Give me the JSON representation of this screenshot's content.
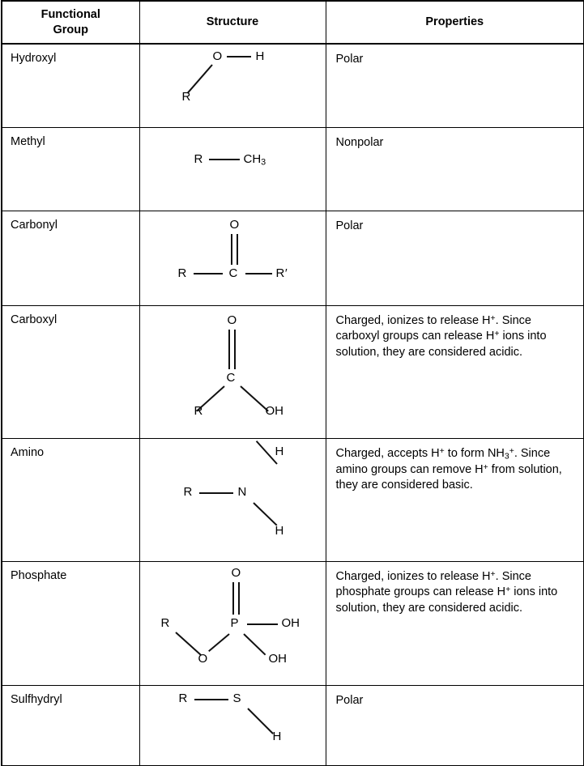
{
  "table": {
    "headers": {
      "group": "Functional Group",
      "group_line1": "Functional",
      "group_line2": "Group",
      "structure": "Structure",
      "properties": "Properties"
    },
    "rows": [
      {
        "group": "Hydroxyl",
        "structure_atoms": [
          "O",
          "H",
          "R"
        ],
        "structure_formula": "R-O-H",
        "properties": "Polar"
      },
      {
        "group": "Methyl",
        "structure_atoms": [
          "R",
          "CH3"
        ],
        "structure_formula": "R-CH3",
        "properties": "Nonpolar"
      },
      {
        "group": "Carbonyl",
        "structure_atoms": [
          "O",
          "R",
          "C",
          "R′"
        ],
        "structure_formula": "R-C(=O)-R′",
        "properties": "Polar"
      },
      {
        "group": "Carboxyl",
        "structure_atoms": [
          "O",
          "C",
          "R",
          "OH"
        ],
        "structure_formula": "R-C(=O)-OH",
        "properties": "Charged, ionizes to release H+. Since carboxyl groups can release H+ ions into solution, they are considered acidic."
      },
      {
        "group": "Amino",
        "structure_atoms": [
          "H",
          "R",
          "N",
          "H"
        ],
        "structure_formula": "R-N(H)(H)",
        "properties": "Charged, accepts H+ to form NH3+. Since amino groups can remove H+ from solution, they are considered basic."
      },
      {
        "group": "Phosphate",
        "structure_atoms": [
          "O",
          "R",
          "P",
          "OH",
          "O",
          "OH"
        ],
        "structure_formula": "R-O-P(=O)(OH)-OH",
        "properties": "Charged, ionizes to release H+. Since phosphate groups can release H+ ions into solution, they are considered acidic."
      },
      {
        "group": "Sulfhydryl",
        "structure_atoms": [
          "R",
          "S",
          "H"
        ],
        "structure_formula": "R-S-H",
        "properties": "Polar"
      }
    ],
    "atom_labels": {
      "O": "O",
      "H": "H",
      "R": "R",
      "R_prime": "R′",
      "C": "C",
      "N": "N",
      "P": "P",
      "S": "S",
      "OH": "OH",
      "CH": "CH",
      "CH_sub": "3"
    },
    "property_text": {
      "polar": "Polar",
      "nonpolar": "Nonpolar",
      "carboxyl_1a": "Charged, ionizes to release H",
      "carboxyl_1b": "+",
      "carboxyl_1c": ". Since carboxyl groups can release H",
      "carboxyl_1d": "+",
      "carboxyl_1e": " ions into solution, they are considered acidic.",
      "amino_1a": "Charged, accepts H",
      "amino_1b": "+",
      "amino_1c": " to form NH",
      "amino_1d": "3",
      "amino_1e": "+",
      "amino_1f": ". Since amino groups can remove H",
      "amino_1g": "+",
      "amino_1h": " from solution, they are considered basic.",
      "phosphate_1a": "Charged, ionizes to release H",
      "phosphate_1b": "+",
      "phosphate_1c": ". Since phosphate groups can release H",
      "phosphate_1d": "+",
      "phosphate_1e": " ions into solution, they are considered acidic."
    },
    "colors": {
      "border": "#000000",
      "text": "#000000",
      "background": "#ffffff",
      "bond": "#111111"
    }
  }
}
